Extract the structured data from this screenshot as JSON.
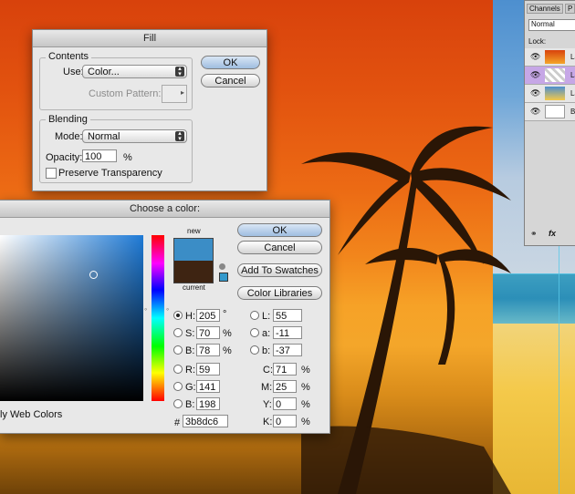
{
  "fill": {
    "title": "Fill",
    "contents_label": "Contents",
    "use_label": "Use:",
    "use_value": "Color...",
    "custom_pattern_label": "Custom Pattern:",
    "blending_label": "Blending",
    "mode_label": "Mode:",
    "mode_value": "Normal",
    "opacity_label": "Opacity:",
    "opacity_value": "100",
    "opacity_unit": "%",
    "preserve_label": "Preserve Transparency",
    "ok": "OK",
    "cancel": "Cancel"
  },
  "picker": {
    "title": "Choose a color:",
    "new_label": "new",
    "current_label": "current",
    "new_color": "#3b8dc6",
    "current_color": "#3e2412",
    "ok": "OK",
    "cancel": "Cancel",
    "add_swatches": "Add To Swatches",
    "libraries": "Color Libraries",
    "only_web": "ly Web Colors",
    "h_label": "H:",
    "h_value": "205",
    "h_unit": "°",
    "s_label": "S:",
    "s_value": "70",
    "s_unit": "%",
    "b_label": "B:",
    "b_value": "78",
    "b_unit": "%",
    "r_label": "R:",
    "r_value": "59",
    "g_label": "G:",
    "g_value": "141",
    "bb_label": "B:",
    "bb_value": "198",
    "l_label": "L:",
    "l_value": "55",
    "a_label": "a:",
    "a_value": "-11",
    "blab_label": "b:",
    "blab_value": "-37",
    "c_label": "C:",
    "c_value": "71",
    "m_label": "M:",
    "m_value": "25",
    "y_label": "Y:",
    "y_value": "0",
    "k_label": "K:",
    "k_value": "0",
    "cmyk_unit": "%",
    "hex_label": "#",
    "hex_value": "3b8dc6"
  },
  "layers": {
    "tab1": "Channels",
    "tab2": "P",
    "blend_mode": "Normal",
    "lock_label": "Lock:",
    "rows": [
      {
        "name": "La"
      },
      {
        "name": "La"
      },
      {
        "name": "La"
      },
      {
        "name": "B"
      }
    ]
  }
}
